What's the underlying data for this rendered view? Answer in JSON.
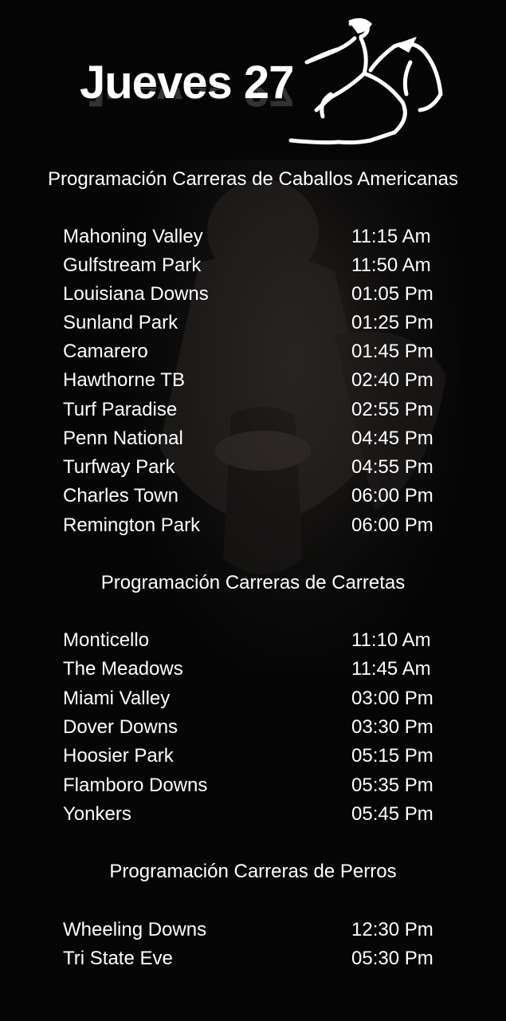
{
  "header": {
    "title": "Jueves 27",
    "logo_icon": "horse-jockey-icon"
  },
  "sections": [
    {
      "title": "Programación Carreras de Caballos Americanas",
      "races": [
        {
          "track": "Mahoning Valley",
          "time": "11:15 Am"
        },
        {
          "track": "Gulfstream Park",
          "time": "11:50 Am"
        },
        {
          "track": "Louisiana Downs",
          "time": "01:05 Pm"
        },
        {
          "track": "Sunland Park",
          "time": "01:25 Pm"
        },
        {
          "track": "Camarero",
          "time": "01:45 Pm"
        },
        {
          "track": "Hawthorne TB",
          "time": "02:40 Pm"
        },
        {
          "track": "Turf Paradise",
          "time": "02:55 Pm"
        },
        {
          "track": "Penn National",
          "time": "04:45 Pm"
        },
        {
          "track": "Turfway Park",
          "time": "04:55 Pm"
        },
        {
          "track": "Charles Town",
          "time": "06:00 Pm"
        },
        {
          "track": "Remington Park",
          "time": "06:00 Pm"
        }
      ]
    },
    {
      "title": "Programación Carreras de Carretas",
      "races": [
        {
          "track": "Monticello",
          "time": "11:10 Am"
        },
        {
          "track": "The Meadows",
          "time": "11:45 Am"
        },
        {
          "track": "Miami Valley",
          "time": "03:00 Pm"
        },
        {
          "track": "Dover Downs",
          "time": "03:30 Pm"
        },
        {
          "track": "Hoosier Park",
          "time": "05:15 Pm"
        },
        {
          "track": "Flamboro Downs",
          "time": "05:35 Pm"
        },
        {
          "track": "Yonkers",
          "time": "05:45 Pm"
        }
      ]
    },
    {
      "title": "Programación Carreras de Perros",
      "races": [
        {
          "track": "Wheeling Downs",
          "time": "12:30 Pm"
        },
        {
          "track": "Tri State Eve",
          "time": "05:30 Pm"
        }
      ]
    }
  ],
  "colors": {
    "background": "#050505",
    "text": "#ffffff"
  }
}
